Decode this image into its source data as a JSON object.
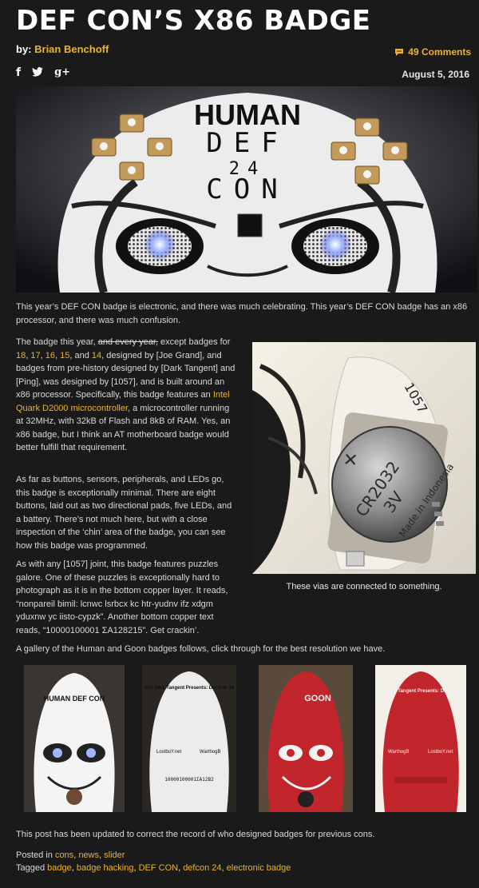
{
  "article": {
    "title": "DEF CON’S X86 BADGE",
    "byline_prefix": "by:",
    "author": "Brian Benchoff",
    "comments": "49 Comments",
    "date": "August 5, 2016"
  },
  "social": {
    "facebook": "f",
    "twitter": "t",
    "googleplus": "g+"
  },
  "hero": {
    "text_lines": [
      "HUMAN",
      "DEF",
      "24",
      "CON"
    ]
  },
  "paragraphs": {
    "intro": "This year’s DEF CON badge is electronic, and there was much celebrating. This year’s DEF CON badge has an x86 processor, and there was much confusion.",
    "p2": {
      "t1": "The badge this year, ",
      "strike": "and every year,",
      "t2": " except badges for ",
      "link18": "18",
      "c1": ", ",
      "link17": "17",
      "c2": ", ",
      "link16": "16",
      "c3": ", ",
      "link15": "15",
      "c4": ", and ",
      "link14": "14",
      "t3": ", designed by [Joe Grand], and badges from pre-history designed by [Dark Tangent] and [Ping], was designed by [1057], and is built around an x86 processor. Specifically, this badge features an ",
      "quark": "Intel Quark D2000 microcontroller",
      "t4": ", a microcontroller running at 32MHz, with 32kB of Flash and 8kB of RAM. Yes, an x86 badge, but I think an AT motherboard badge would better fulfill that requirement."
    },
    "p3": "As far as buttons, sensors, peripherals, and LEDs go, this badge is exceptionally minimal. There are eight buttons, laid out as two directional pads, five LEDs, and a battery. There’s not much here, but with a close inspection of the ‘chin’ area of the badge, you can see how this badge was programmed.",
    "p4": "As with any [1057] joint, this badge features puzzles galore. One of these puzzles is exceptionally hard to photograph as it is in the bottom copper layer. It reads, “nonpareil bimil: lcnwc lsrbcx kc htr-yudnv ifz xdgm yduxnw yc iisto-cypzk”. Another bottom copper text reads, “10000100001 ΣA128215”. Get crackin’.",
    "gallery_intro": "A gallery of the Human and Goon badges follows, click through for the best resolution we have.",
    "update": "This post has been updated to correct the record of who designed badges for previous cons."
  },
  "side_photo": {
    "caption": "These vias are connected to something.",
    "battery_text": [
      "+",
      "CR2032",
      "3V",
      "Made in Indonesia"
    ],
    "board_text": "1057"
  },
  "gallery": [
    {
      "label": "HUMAN DEF CON",
      "bg": "#f2f2f2",
      "frame": "#f6f6f6"
    },
    {
      "label": "The Dark Tangent Presents: Def Con 24",
      "sub1": "LostboY.net",
      "sub2": "WarthogB",
      "code": "10000100001ΣA12B2",
      "bg": "#ededed"
    },
    {
      "label": "GOON",
      "bg": "#c0262b"
    },
    {
      "label": "The Dark Tangent Presents: Def Con 24",
      "sub1": "WarthogB",
      "sub2": "LostboY.net",
      "bg": "#c0262b"
    }
  ],
  "footer": {
    "posted_in": "Posted in",
    "cats": [
      "cons",
      "news",
      "slider"
    ],
    "tagged": "Tagged",
    "tags": [
      "badge",
      "badge hacking",
      "DEF CON",
      "defcon 24",
      "electronic badge"
    ],
    "sep": ", "
  },
  "colors": {
    "accent": "#f0b323",
    "background": "#1a1a1a",
    "text": "#e6e6e6",
    "badge_red": "#c0262b"
  },
  "icons": [
    "facebook-icon",
    "twitter-icon",
    "google-plus-icon",
    "comment-bubble-icon"
  ]
}
